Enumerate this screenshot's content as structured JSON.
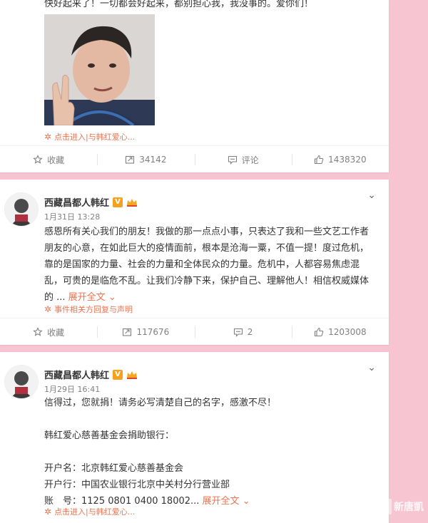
{
  "post1": {
    "top_text": "快好起来了！一切都会好起来，都别担心我，我没事的。爱你们！",
    "source": "点击进入|与韩红爱心...",
    "actions": {
      "favorite": "收藏",
      "repost": "34142",
      "comment": "评论",
      "like": "1438320"
    }
  },
  "post2": {
    "author": "西藏昌都人韩红",
    "verified": "V",
    "time": "1月31日 13:28",
    "lines": [
      "感恩所有关心我们的朋友！我做的那一点点小事，只表达了我和一些文艺工作者",
      "朋友的心意，在如此巨大的疫情面前，根本是沧海一粟，不值一提！度过危机，",
      "靠的是国家的力量、社会的力量和全体民众的力量。危机中，人都容易焦虑混",
      "乱，可贵的是临危不乱。让我们冷静下来，保护自己、理解他人！相信权威媒体"
    ],
    "last_line": "的 ...",
    "expand": "展开全文",
    "source": "事件相关方回复与声明",
    "actions": {
      "favorite": "收藏",
      "repost": "117676",
      "comment": "2",
      "like": "1203008"
    }
  },
  "post3": {
    "author": "西藏昌都人韩红",
    "verified": "V",
    "time": "1月29日 16:41",
    "line1": "信得过，您就捐！请务必写清楚自己的名字，感激不尽！",
    "line2": "韩红爱心慈善基金会捐助银行：",
    "account_name": "开户名：北京韩红爱心慈善基金会",
    "bank": "开户行：中国农业银行北京中关村分行营业部",
    "account_no": "账　号：1125 0801 0400 18002...",
    "expand": "展开全文",
    "source": "点击进入|与韩红爱心..."
  },
  "watermark": "新唐凱",
  "colors": {
    "background": "#f7c5d2",
    "link": "#eb7350",
    "muted": "#808080",
    "verified": "#f7a01d"
  }
}
